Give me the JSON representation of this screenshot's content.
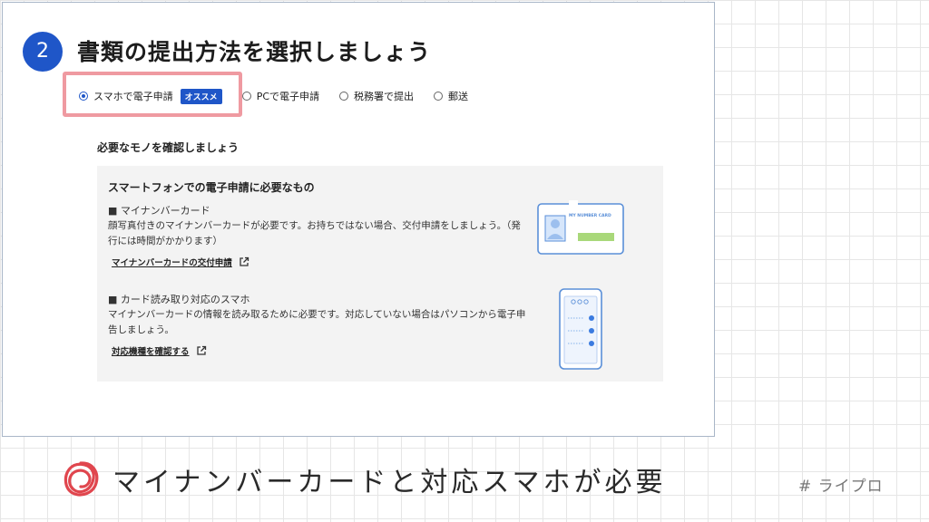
{
  "step": {
    "number": "2",
    "title": "書類の提出方法を選択しましょう"
  },
  "options": [
    {
      "label": "スマホで電子申請",
      "badge": "オススメ",
      "selected": true
    },
    {
      "label": "PCで電子申請",
      "selected": false
    },
    {
      "label": "税務署で提出",
      "selected": false
    },
    {
      "label": "郵送",
      "selected": false
    }
  ],
  "requirements": {
    "heading": "必要なモノを確認しましょう",
    "box_title": "スマートフォンでの電子申請に必要なもの",
    "items": [
      {
        "title": "■ マイナンバーカード",
        "desc": "顔写真付きのマイナンバーカードが必要です。お持ちではない場合、交付申請をしましょう。（発行には時間がかかります）",
        "link": "マイナンバーカードの交付申請",
        "link_icon": "external-link-icon"
      },
      {
        "title": "■ カード読み取り対応のスマホ",
        "desc": "マイナンバーカードの情報を読み取るために必要です。対応していない場合はパソコンから電子申告しましょう。",
        "link": "対応機種を確認する",
        "link_icon": "external-link-icon"
      }
    ],
    "card_illustration_text": "MY NUMBER CARD"
  },
  "caption": {
    "text": "マイナンバーカードと対応スマホが必要",
    "icon": "red-scribble-circle-icon"
  },
  "hashtag": "# ライプロ",
  "colors": {
    "accent": "#1f56c8",
    "highlight": "#ef9aa1",
    "caption_mark": "#e0464e"
  }
}
